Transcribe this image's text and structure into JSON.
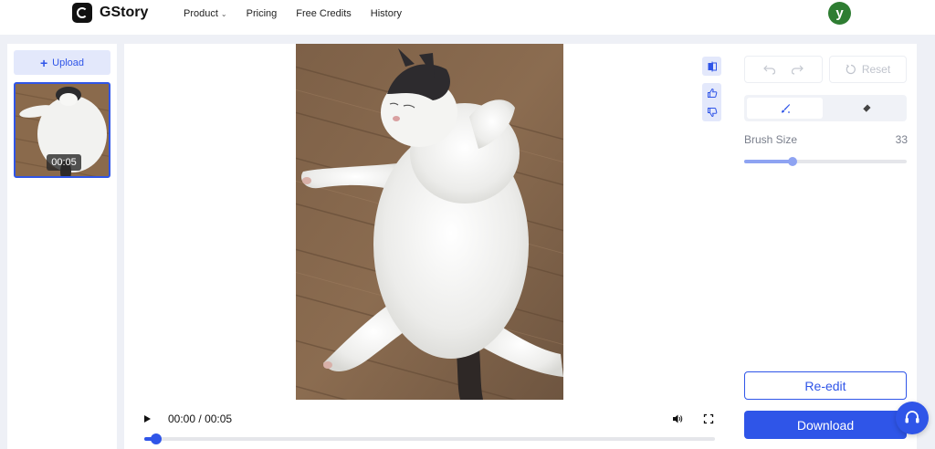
{
  "header": {
    "brand": "GStory",
    "nav": [
      {
        "label": "Product",
        "has_dropdown": true
      },
      {
        "label": "Pricing",
        "has_dropdown": false
      },
      {
        "label": "Free Credits",
        "has_dropdown": false
      },
      {
        "label": "History",
        "has_dropdown": false
      }
    ],
    "avatar_initial": "y",
    "avatar_color": "#2e7d32"
  },
  "sidebar": {
    "upload_label": "Upload",
    "thumbnails": [
      {
        "duration": "00:05"
      }
    ]
  },
  "player": {
    "current_time": "00:00",
    "separator": "/",
    "total_time": "00:05",
    "progress": 0.02
  },
  "tools": {
    "reset_label": "Reset",
    "brush_size_label": "Brush Size",
    "brush_size_value": "33",
    "brush_size_fraction": 0.3,
    "reedit_label": "Re-edit",
    "download_label": "Download"
  },
  "colors": {
    "accent": "#2f55e8",
    "accent_light": "#e3e8fb",
    "slider": "#8ea3f2"
  },
  "icons": {
    "logo": "gstory-logo-icon",
    "play": "play-icon",
    "volume": "volume-icon",
    "fullscreen": "fullscreen-icon",
    "undo": "undo-icon",
    "redo": "redo-icon",
    "reset": "reset-icon",
    "brush": "brush-icon",
    "eraser": "eraser-icon",
    "compare": "compare-icon",
    "thumbs_up": "thumbs-up-icon",
    "thumbs_down": "thumbs-down-icon",
    "support": "headset-icon"
  }
}
